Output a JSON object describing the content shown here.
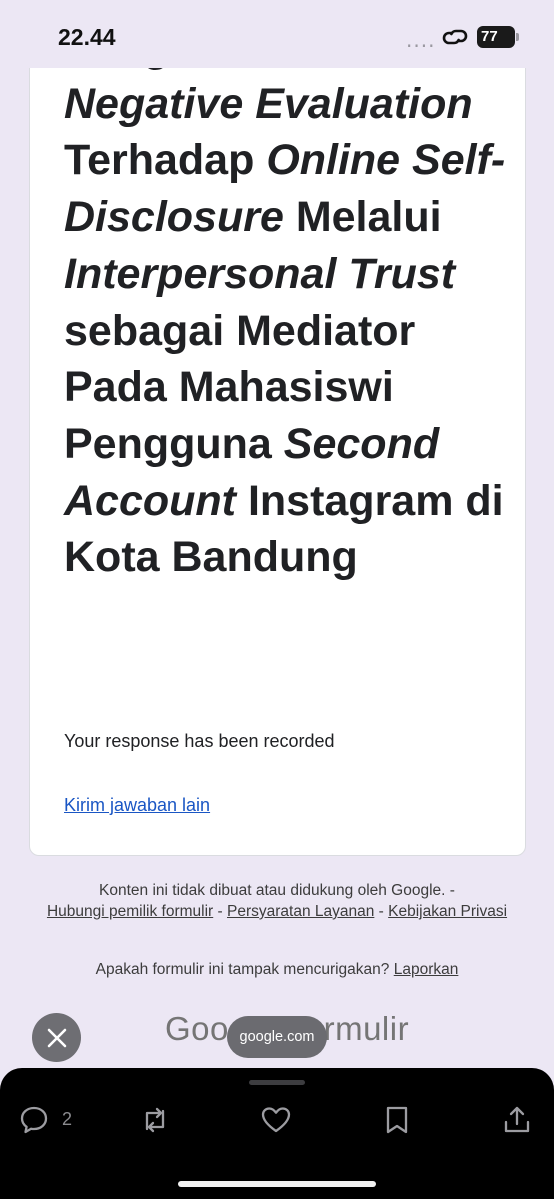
{
  "status_bar": {
    "time": "22.44",
    "signal": "....",
    "battery": "77"
  },
  "form": {
    "title_parts": [
      {
        "text": "Pengaruh ",
        "italic": false
      },
      {
        "text": "Fear of ",
        "italic": false
      },
      {
        "text": "Negative Evaluation",
        "italic": true
      },
      {
        "text": " Terhadap ",
        "italic": false
      },
      {
        "text": "Online Self-Disclosure",
        "italic": true
      },
      {
        "text": " Melalui ",
        "italic": false
      },
      {
        "text": "Interpersonal Trust",
        "italic": true
      },
      {
        "text": " sebagai Mediator Pada Mahasiswi Pengguna ",
        "italic": false
      },
      {
        "text": "Second Account",
        "italic": true
      },
      {
        "text": " Instagram di Kota Bandung",
        "italic": false
      }
    ],
    "response_message": "Your response has been recorded",
    "submit_another_link": "Kirim jawaban lain"
  },
  "footer": {
    "disclaimer": "Konten ini tidak dibuat atau didukung oleh Google. -",
    "contact_owner": "Hubungi pemilik formulir",
    "terms": "Persyaratan Layanan",
    "privacy": "Kebijakan Privasi",
    "separator": " - ",
    "suspicious_question": "Apakah formulir ini tampak mencurigakan?",
    "report": "Laporkan",
    "logo_google": "Google",
    "logo_forms": "Formulir"
  },
  "overlay": {
    "url": "google.com"
  },
  "bottom_bar": {
    "reply_count": "2"
  },
  "colors": {
    "page_bg": "#ece7f4",
    "link": "#1a56c4",
    "bottom_bar": "#000000"
  },
  "icons": [
    "chat-bubble-icon",
    "repost-icon",
    "heart-icon",
    "bookmark-icon",
    "share-icon",
    "close-icon",
    "link-icon"
  ]
}
